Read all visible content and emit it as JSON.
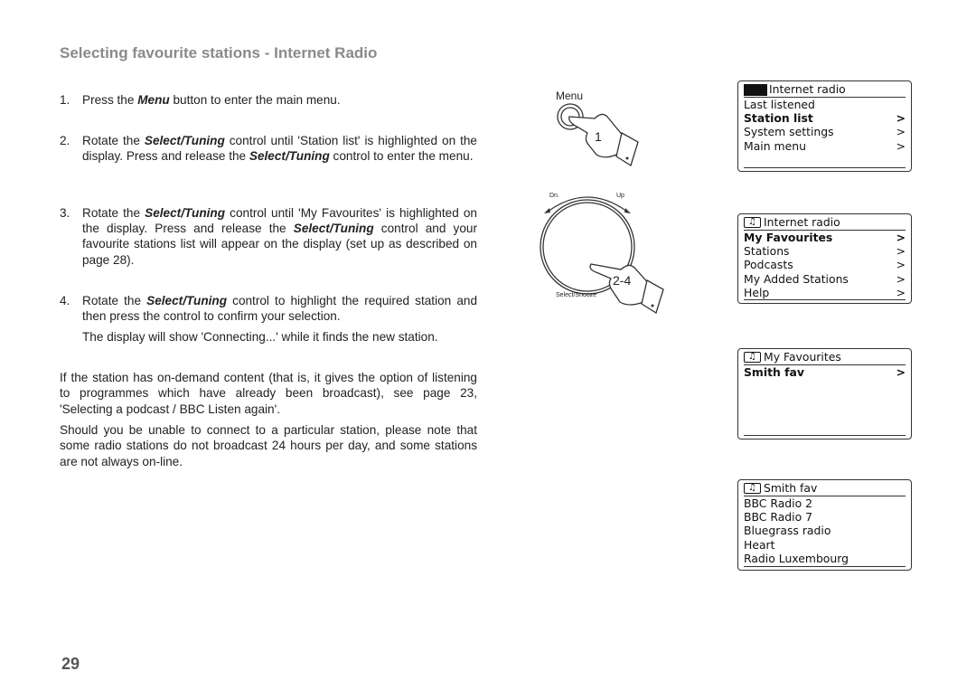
{
  "title": "Selecting favourite stations - Internet Radio",
  "steps": [
    {
      "num": "1.",
      "p": [
        "Press the ",
        "Menu",
        " button to enter the main menu."
      ]
    },
    {
      "num": "2.",
      "p": [
        "Rotate the ",
        "Select/Tuning",
        " control until 'Station list' is highlighted on the display. Press and release the ",
        "Select/Tuning",
        " control to enter the menu."
      ]
    },
    {
      "num": "3.",
      "p": [
        "Rotate the ",
        "Select/Tuning",
        " control until 'My Favourites' is highlighted on the display. Press and release the ",
        "Select/Tuning",
        " control and your favourite stations list will appear on the display (set up as described on page 28)."
      ]
    },
    {
      "num": "4.",
      "p": [
        "Rotate the ",
        "Select/Tuning",
        " control to highlight the required station and then press the control to confirm your selection."
      ]
    }
  ],
  "step4_note": "The display will show 'Connecting...' while it finds the new station.",
  "para1": "If the station has on-demand content (that is, it gives the option of listening to programmes which have already been broadcast), see page 23, 'Selecting a podcast / BBC Listen again'.",
  "para2": "Should you be unable to connect to a particular station, please note that some radio stations do not broadcast 24 hours per day, and some stations are not always on-line.",
  "page_number": "29",
  "illustrations": {
    "menu_label": "Menu",
    "menu_step": "1",
    "dial_dn": "Dn.",
    "dial_up": "Up",
    "dial_step": "2-4",
    "dial_label": "Select/Snooze"
  },
  "screens": [
    {
      "header": "Internet radio",
      "header_icon": "black-block",
      "rows": [
        {
          "label": "Last listened",
          "arrow": "",
          "bold": false
        },
        {
          "label": "Station list",
          "arrow": ">",
          "bold": true
        },
        {
          "label": "System settings",
          "arrow": ">",
          "bold": false
        },
        {
          "label": "Main menu",
          "arrow": ">",
          "bold": false
        }
      ]
    },
    {
      "header": "Internet radio",
      "header_icon": "music-note-icon",
      "rows": [
        {
          "label": "My Favourites",
          "arrow": ">",
          "bold": true
        },
        {
          "label": "Stations",
          "arrow": ">",
          "bold": false
        },
        {
          "label": "Podcasts",
          "arrow": ">",
          "bold": false
        },
        {
          "label": "My Added Stations",
          "arrow": ">",
          "bold": false
        },
        {
          "label": "Help",
          "arrow": ">",
          "bold": false
        }
      ]
    },
    {
      "header": "My Favourites",
      "header_icon": "music-note-icon",
      "rows": [
        {
          "label": "Smith fav",
          "arrow": ">",
          "bold": true
        }
      ]
    },
    {
      "header": "Smith fav",
      "header_icon": "music-note-icon",
      "rows": [
        {
          "label": "BBC Radio 2",
          "arrow": "",
          "bold": false
        },
        {
          "label": "BBC Radio 7",
          "arrow": "",
          "bold": false
        },
        {
          "label": "Bluegrass radio",
          "arrow": "",
          "bold": false
        },
        {
          "label": "Heart",
          "arrow": "",
          "bold": false
        },
        {
          "label": "Radio Luxembourg",
          "arrow": "",
          "bold": false
        }
      ]
    }
  ]
}
